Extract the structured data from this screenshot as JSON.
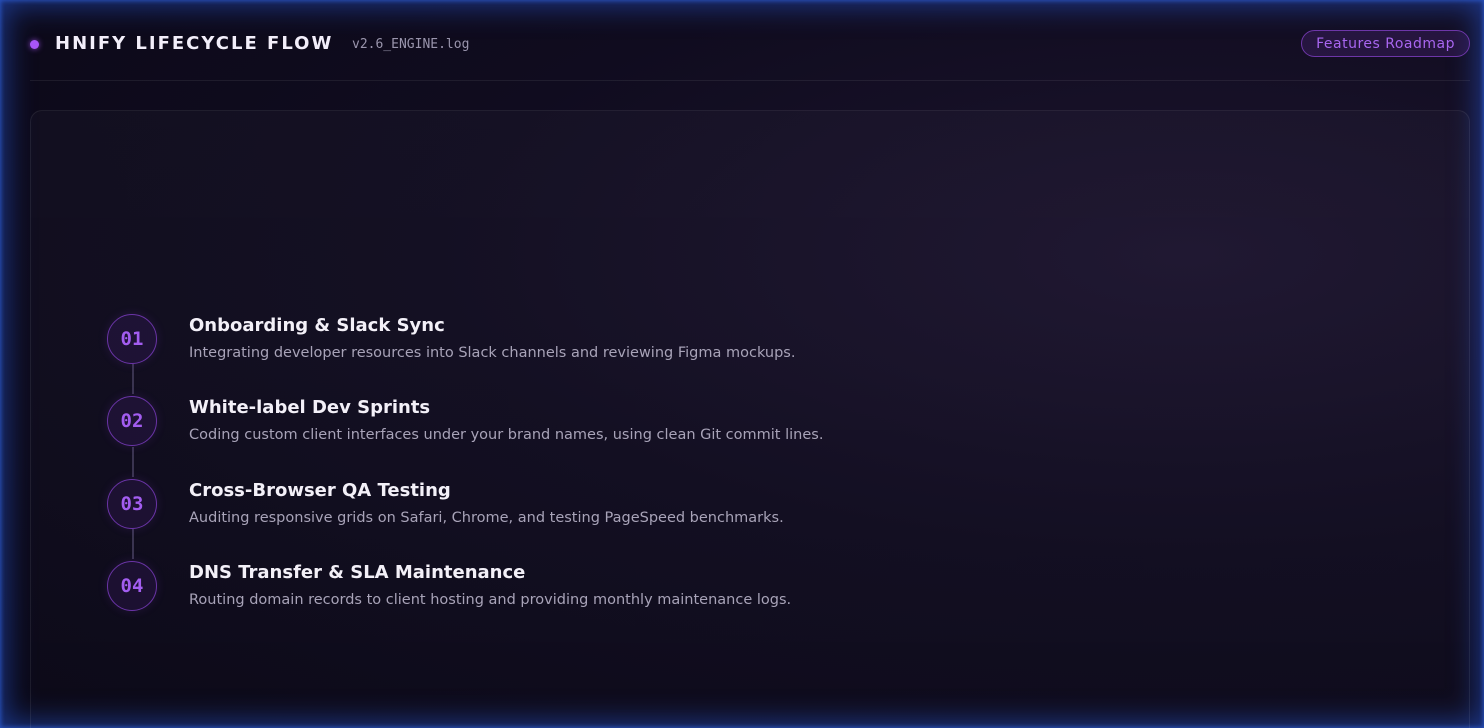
{
  "header": {
    "title": "HNIFY LIFECYCLE FLOW",
    "version": "v2.6_ENGINE.log",
    "roadmap_button": "Features Roadmap"
  },
  "steps": [
    {
      "number": "01",
      "title": "Onboarding & Slack Sync",
      "description": "Integrating developer resources into Slack channels and reviewing Figma mockups."
    },
    {
      "number": "02",
      "title": "White-label Dev Sprints",
      "description": "Coding custom client interfaces under your brand names, using clean Git commit lines."
    },
    {
      "number": "03",
      "title": "Cross-Browser QA Testing",
      "description": "Auditing responsive grids on Safari, Chrome, and testing PageSpeed benchmarks."
    },
    {
      "number": "04",
      "title": "DNS Transfer & SLA Maintenance",
      "description": "Routing domain records to client hosting and providing monthly maintenance logs."
    }
  ],
  "colors": {
    "accent": "#a855f7",
    "background": "#0a0818",
    "frame_glow": "#2a5adc"
  }
}
